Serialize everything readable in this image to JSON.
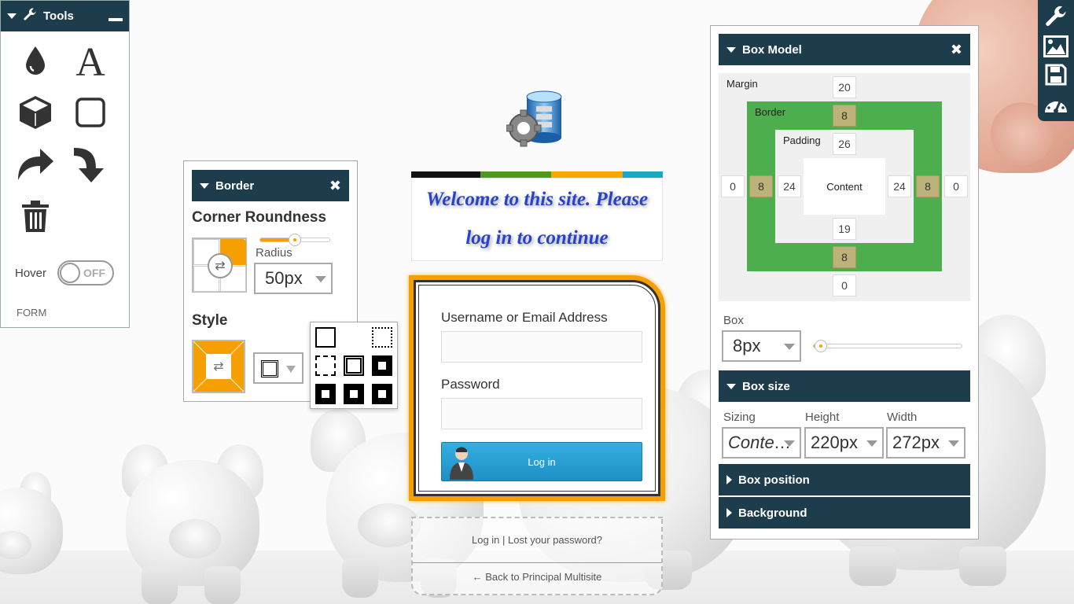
{
  "tools_panel": {
    "title": "Tools",
    "icons": [
      "droplet-icon",
      "text-icon",
      "cube-icon",
      "square-icon",
      "redo-icon",
      "turn-down-icon",
      "trash-icon"
    ],
    "hover_label": "Hover",
    "hover_toggle": "OFF",
    "footer_label": "FORM"
  },
  "border_panel": {
    "title": "Border",
    "corner_title": "Corner Roundness",
    "radius_label": "Radius",
    "radius_value": "50px",
    "radius_slider_fraction": 0.5,
    "style_title": "Style"
  },
  "login": {
    "welcome_line1": "Welcome to this site. Please",
    "welcome_line2": "log in to continue",
    "colorbar": [
      "#111111",
      "#4e9a1e",
      "#f2a900",
      "#1ca7c9"
    ],
    "username_label": "Username or Email Address",
    "username_value": "",
    "password_label": "Password",
    "password_value": "",
    "login_button": "Log in",
    "nav_login": "Log in",
    "nav_sep": "|",
    "nav_lost": "Lost your password?",
    "back_link": "← Back to Principal Multisite"
  },
  "box_model": {
    "title": "Box Model",
    "margin_label": "Margin",
    "border_label": "Border",
    "padding_label": "Padding",
    "content_label": "Content",
    "margin": {
      "top": "20",
      "right": "0",
      "bottom": "0",
      "left": "0"
    },
    "border": {
      "top": "8",
      "right": "8",
      "bottom": "8",
      "left": "8"
    },
    "padding": {
      "top": "26",
      "right": "24",
      "bottom": "19",
      "left": "24"
    },
    "box_label": "Box",
    "box_value": "8px",
    "box_slider_fraction": 0.05,
    "box_size_title": "Box size",
    "sizing_label": "Sizing",
    "sizing_value": "Conte…",
    "height_label": "Height",
    "height_value": "220px",
    "width_label": "Width",
    "width_value": "272px",
    "box_position_title": "Box position",
    "background_title": "Background"
  },
  "right_toolbar": [
    "wrench-icon",
    "image-icon",
    "save-icon",
    "dashboard-icon"
  ],
  "colors": {
    "panel_header": "#1d3d4d",
    "accent": "#f5a000",
    "border_green": "#4cae4c",
    "button_blue": "#2a9fd6"
  }
}
